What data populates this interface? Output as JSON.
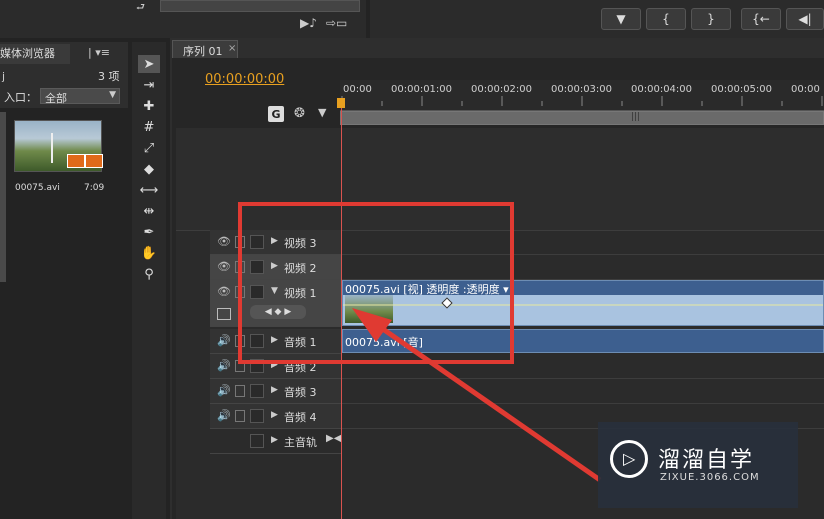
{
  "top_bar": {
    "transport_buttons": [
      "▼",
      "{",
      "}",
      "{←",
      "◀|"
    ]
  },
  "media_browser": {
    "tab_label": "媒体浏览器",
    "tab_menu": "| ▾≡",
    "project_suffix": "j",
    "item_count": "3 项",
    "entry_label": "入口：",
    "entry_value": "全部",
    "clip_name": "00075.avi",
    "clip_duration": "7:09"
  },
  "sequence": {
    "tab_label": "序列 01",
    "tab_close": "×",
    "timecode": "00:00:00:00",
    "ruler_labels": [
      "00:00",
      "00:00:01:00",
      "00:00:02:00",
      "00:00:03:00",
      "00:00:04:00",
      "00:00:05:00",
      "00:00"
    ]
  },
  "tracks": {
    "video3": "视频 3",
    "video2": "视频 2",
    "video1": "视频 1",
    "audio1": "音频 1",
    "audio2": "音频 2",
    "audio3": "音频 3",
    "audio4": "音频 4",
    "master": "主音轨"
  },
  "clips": {
    "video_clip_label": "00075.avi  [视]  透明度 :透明度 ▾",
    "audio_clip_label": "00075.avi  [音]"
  },
  "watermark": {
    "title": "溜溜自学",
    "url": "ZIXUE.3066.COM"
  },
  "colors": {
    "highlight_box": "#e03a32",
    "arrow": "#e03a32",
    "timecode": "#e8a020",
    "video_clip": "#a9c3e0",
    "audio_clip": "#3d5f8f",
    "playhead": "#d9534f"
  }
}
